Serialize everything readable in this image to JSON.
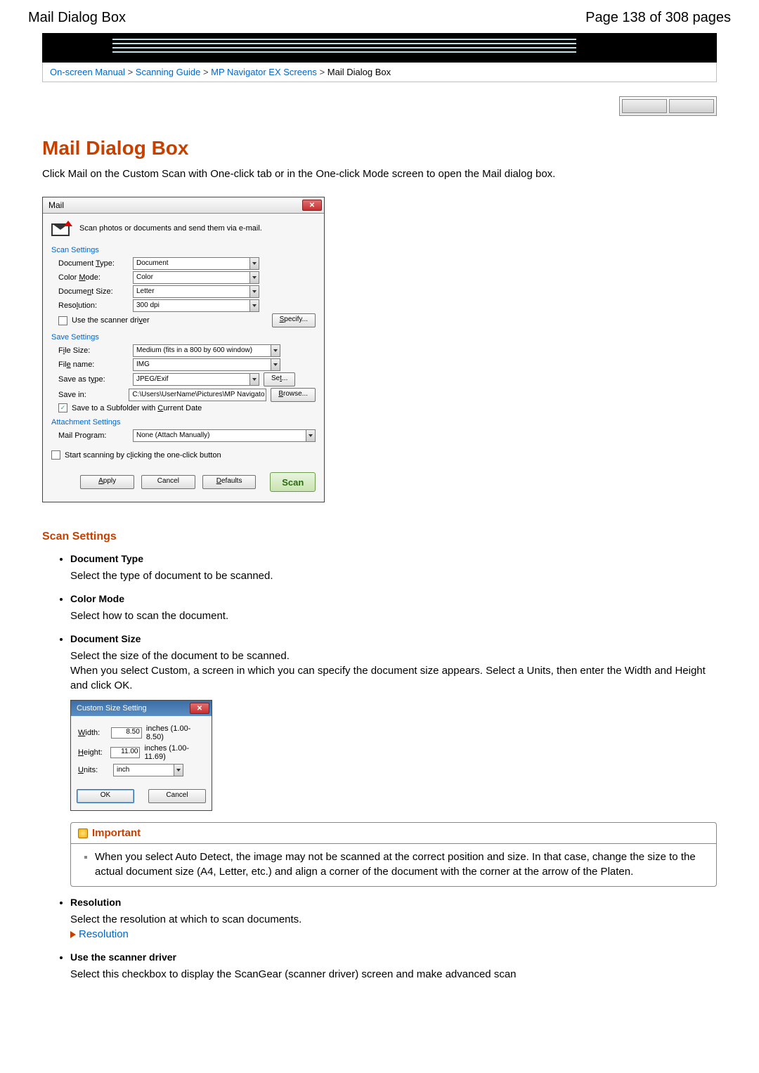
{
  "header": {
    "left": "Mail Dialog Box",
    "right": "Page 138 of 308 pages"
  },
  "breadcrumb": {
    "items": [
      "On-screen Manual",
      "Scanning Guide",
      "MP Navigator EX Screens"
    ],
    "current": "Mail Dialog Box",
    "sep": ">"
  },
  "title": "Mail Dialog Box",
  "intro": "Click Mail on the Custom Scan with One-click tab or in the One-click Mode screen to open the Mail dialog box.",
  "dialog": {
    "title": "Mail",
    "subtitle": "Scan photos or documents and send them via e-mail.",
    "groups": {
      "scan": "Scan Settings",
      "save": "Save Settings",
      "attach": "Attachment Settings"
    },
    "scan": {
      "docTypeLabel": "Document Type:",
      "docType": "Document",
      "colorModeLabel": "Color Mode:",
      "colorMode": "Color",
      "docSizeLabel": "Document Size:",
      "docSize": "Letter",
      "resolutionLabel": "Resolution:",
      "resolution": "300 dpi",
      "useDriver": "Use the scanner driver",
      "specifyBtn": "Specify..."
    },
    "save": {
      "fileSizeLabel": "File Size:",
      "fileSize": "Medium (fits in a 800 by 600 window)",
      "fileNameLabel": "File name:",
      "fileName": "IMG",
      "saveAsTypeLabel": "Save as type:",
      "saveAsType": "JPEG/Exif",
      "setBtn": "Set...",
      "saveInLabel": "Save in:",
      "saveIn": "C:\\Users\\UserName\\Pictures\\MP Navigato",
      "browseBtn": "Browse...",
      "subfolder": "Save to a Subfolder with Current Date"
    },
    "attach": {
      "mailProgLabel": "Mail Program:",
      "mailProg": "None (Attach Manually)"
    },
    "startOneClick": "Start scanning by clicking the one-click button",
    "buttons": {
      "apply": "Apply",
      "cancel": "Cancel",
      "defaults": "Defaults",
      "scan": "Scan"
    }
  },
  "sections": {
    "scanSettings": "Scan Settings",
    "items": [
      {
        "title": "Document Type",
        "desc": "Select the type of document to be scanned."
      },
      {
        "title": "Color Mode",
        "desc": "Select how to scan the document."
      },
      {
        "title": "Document Size",
        "desc": "Select the size of the document to be scanned.\nWhen you select Custom, a screen in which you can specify the document size appears. Select a Units, then enter the Width and Height and click OK."
      },
      {
        "title": "Resolution",
        "desc": "Select the resolution at which to scan documents.",
        "link": "Resolution"
      },
      {
        "title": "Use the scanner driver",
        "desc": "Select this checkbox to display the ScanGear (scanner driver) screen and make advanced scan"
      }
    ]
  },
  "customSize": {
    "title": "Custom Size Setting",
    "widthLabel": "Width:",
    "width": "8.50",
    "widthRange": "inches (1.00-8.50)",
    "heightLabel": "Height:",
    "height": "11.00",
    "heightRange": "inches (1.00-11.69)",
    "unitsLabel": "Units:",
    "units": "inch",
    "ok": "OK",
    "cancel": "Cancel"
  },
  "important": {
    "title": "Important",
    "text": "When you select Auto Detect, the image may not be scanned at the correct position and size. In that case, change the size to the actual document size (A4, Letter, etc.) and align a corner of the document with the corner at the arrow of the Platen."
  }
}
